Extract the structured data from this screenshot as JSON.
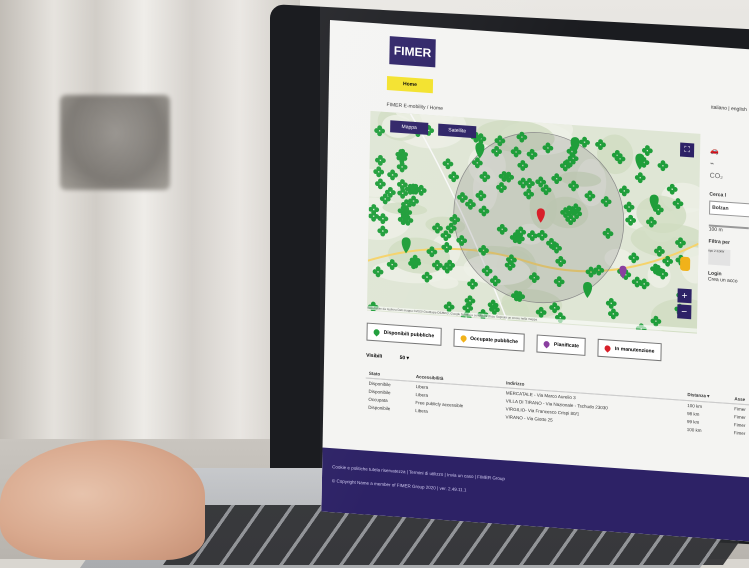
{
  "site": {
    "logo": "FIMER",
    "nav_home": "Home",
    "languages": "italiano | english",
    "breadcrumb": "FIMER E-mobility / Home"
  },
  "map": {
    "tab_map": "Mappa",
    "tab_satellite": "Satellite",
    "zoom_in": "+",
    "zoom_out": "−",
    "footer": "Scorciatoie da tastiera   Dati mappa ©2020 GeoBasis-DE/BKG, Google   Termini e condizioni d'uso   Segnala un errore nella mappa"
  },
  "sidebar": {
    "search_title": "Cerca l",
    "search_value": "Bolzan",
    "radius": "100 m",
    "filter_title": "Filtra per",
    "chip": "tipo 2 22kW",
    "login_title": "Login",
    "login_text": "Crea un acco"
  },
  "legend": [
    {
      "label": "Disponibili pubbliche",
      "color": "#1f9e3a"
    },
    {
      "label": "Occupate pubbliche",
      "color": "#f1b21a"
    },
    {
      "label": "Pianificate",
      "color": "#8a3fa0"
    },
    {
      "label": "In manutenzione",
      "color": "#d8202a"
    }
  ],
  "visibility": {
    "label": "Visibili",
    "value": "50 ▾"
  },
  "table": {
    "headers": [
      "Stato",
      "Accessibilità",
      "Indirizzo",
      "Distanza ▾",
      "Asse"
    ],
    "rows": [
      [
        "Disponibile",
        "Libera",
        "MERCATALE - Via Marco Aurelio 3",
        "100 km",
        "Fimer"
      ],
      [
        "Disponibile",
        "Libera",
        "VILLA DI TIRANO - Via Nazionale - Tschudo 23030",
        "98 km",
        "Fimer"
      ],
      [
        "Occupata",
        "Free publicly accessible",
        "VIRGILIO- Via Francesco Crispi 80/1",
        "99 km",
        "Fimer"
      ],
      [
        "Disponibile",
        "Libera",
        "VIRANO - Via Giotto 25",
        "100 km",
        "Fimer"
      ]
    ]
  },
  "footer": {
    "line1": "Cookie e politiche tutela riservatezza | Termini di utilizzo | Invia un caso | FIMER Group",
    "line2": "© Copyright Name a member of FIMER Group 2020 | ver. 2.49.11.1"
  },
  "colors": {
    "brand": "#2d2266",
    "accent": "#f3e22a",
    "marker": "#1f9e3a"
  }
}
